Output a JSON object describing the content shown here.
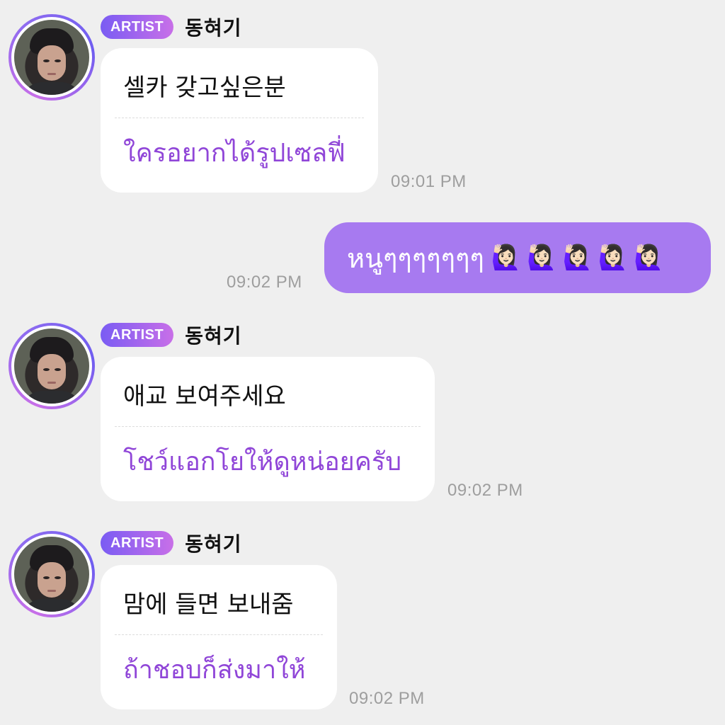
{
  "messages": [
    {
      "badge": "ARTIST",
      "name": "동혀기",
      "original": "셀카 갖고싶은분",
      "translation": "ใครอยากได้รูปเซลฟี่",
      "time": "09:01 PM"
    },
    {
      "badge": "ARTIST",
      "name": "동혀기",
      "original": "애교 보여주세요",
      "translation": "โชว์แอกโยให้ดูหน่อยครับ",
      "time": "09:02 PM"
    },
    {
      "badge": "ARTIST",
      "name": "동혀기",
      "original": "맘에 들면 보내줌",
      "translation": "ถ้าชอบก็ส่งมาให้",
      "time": "09:02 PM"
    }
  ],
  "reply": {
    "text": "หนูๆๆๆๆๆๆๆ",
    "emoji": "🙋🏻‍♀️🙋🏻‍♀️🙋🏻‍♀️🙋🏻‍♀️🙋🏻‍♀️",
    "time": "09:02 PM"
  },
  "colors": {
    "background": "#efefef",
    "reply_bubble": "#a77af0",
    "translation_text": "#9046d8",
    "badge_start": "#7a5cf3",
    "badge_end": "#c86fe8"
  }
}
